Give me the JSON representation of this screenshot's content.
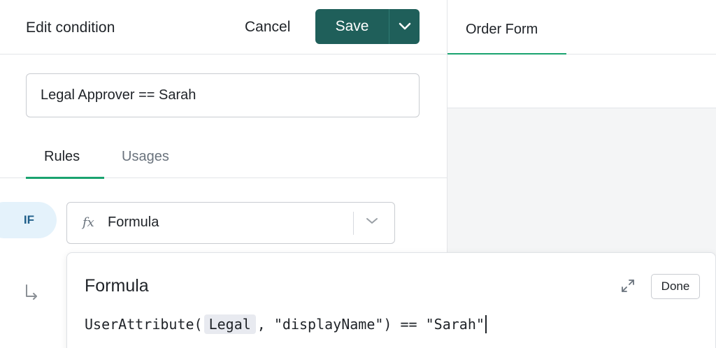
{
  "header": {
    "title": "Edit condition",
    "cancel_label": "Cancel",
    "save_label": "Save"
  },
  "condition_name": {
    "value": "Legal Approver == Sarah"
  },
  "tabs": [
    {
      "label": "Rules",
      "active": true
    },
    {
      "label": "Usages",
      "active": false
    }
  ],
  "rule": {
    "if_label": "IF",
    "selected_type": "Formula",
    "type_icon": "fx-icon"
  },
  "formula_popover": {
    "title": "Formula",
    "done_label": "Done",
    "code_prefix": "UserAttribute(",
    "code_token": "Legal",
    "code_suffix": ", \"displayName\") == \"Sarah\""
  },
  "preview": {
    "tab_label": "Order Form"
  },
  "colors": {
    "primary": "#1f5f5a",
    "accent_green": "#1aa36f",
    "if_pill_bg": "#e4f2fb",
    "if_pill_text": "#1f5f8a"
  }
}
